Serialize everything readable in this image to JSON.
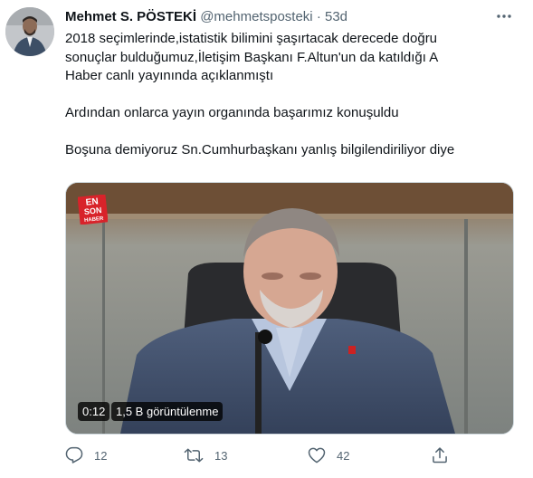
{
  "tweet": {
    "author_name": "Mehmet S. PÖSTEKİ",
    "handle": "@mehmetsposteki",
    "separator": "·",
    "time": "53d",
    "lines": [
      "2018 seçimlerinde,istatistik bilimini şaşırtacak derecede doğru",
      "sonuçlar bulduğumuz,İletişim Başkanı F.Altun'un da katıldığı A",
      "Haber canlı yayınında açıklanmıştı",
      "Ardından onlarca yayın organında başarımız konuşuldu",
      "Boşuna demiyoruz Sn.Cumhurbaşkanı yanlış bilgilendiriliyor diye"
    ]
  },
  "media": {
    "logo_text": [
      "EN",
      "SON",
      "HABER"
    ],
    "duration": "0:12",
    "views": "1,5 B görüntülenme"
  },
  "actions": {
    "replies": "12",
    "retweets": "13",
    "likes": "42"
  },
  "icons": {
    "more": "more-icon",
    "reply": "reply-icon",
    "retweet": "retweet-icon",
    "like": "heart-icon",
    "share": "share-icon"
  },
  "colors": {
    "text": "#0f1419",
    "secondary": "#536471",
    "border": "#cfd9de",
    "logo_red": "#d8232a"
  }
}
